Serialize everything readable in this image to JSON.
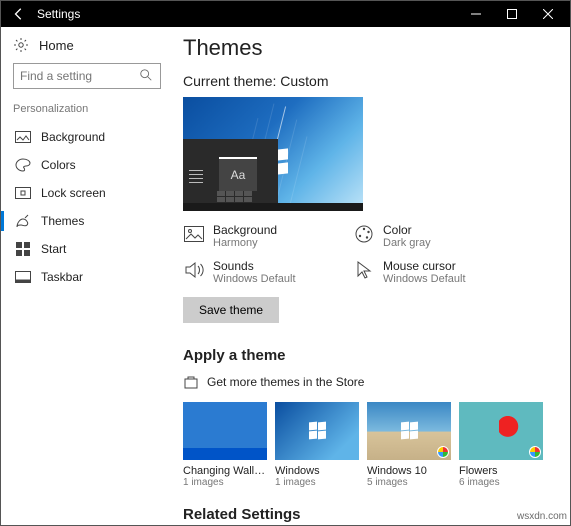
{
  "titlebar": {
    "title": "Settings"
  },
  "sidebar": {
    "home": "Home",
    "search_placeholder": "Find a setting",
    "section": "Personalization",
    "items": [
      {
        "label": "Background"
      },
      {
        "label": "Colors"
      },
      {
        "label": "Lock screen"
      },
      {
        "label": "Themes"
      },
      {
        "label": "Start"
      },
      {
        "label": "Taskbar"
      }
    ]
  },
  "page": {
    "heading": "Themes",
    "current_theme_label": "Current theme: Custom",
    "preview_aa": "Aa",
    "properties": [
      {
        "label": "Background",
        "value": "Harmony"
      },
      {
        "label": "Color",
        "value": "Dark gray"
      },
      {
        "label": "Sounds",
        "value": "Windows Default"
      },
      {
        "label": "Mouse cursor",
        "value": "Windows Default"
      }
    ],
    "save_button": "Save theme",
    "apply_heading": "Apply a theme",
    "store_link": "Get more themes in the Store",
    "themes": [
      {
        "name": "Changing Wallpaper",
        "sub": "1 images"
      },
      {
        "name": "Windows",
        "sub": "1 images"
      },
      {
        "name": "Windows 10",
        "sub": "5 images"
      },
      {
        "name": "Flowers",
        "sub": "6 images"
      }
    ],
    "related_heading": "Related Settings"
  },
  "watermark": "wsxdn.com"
}
